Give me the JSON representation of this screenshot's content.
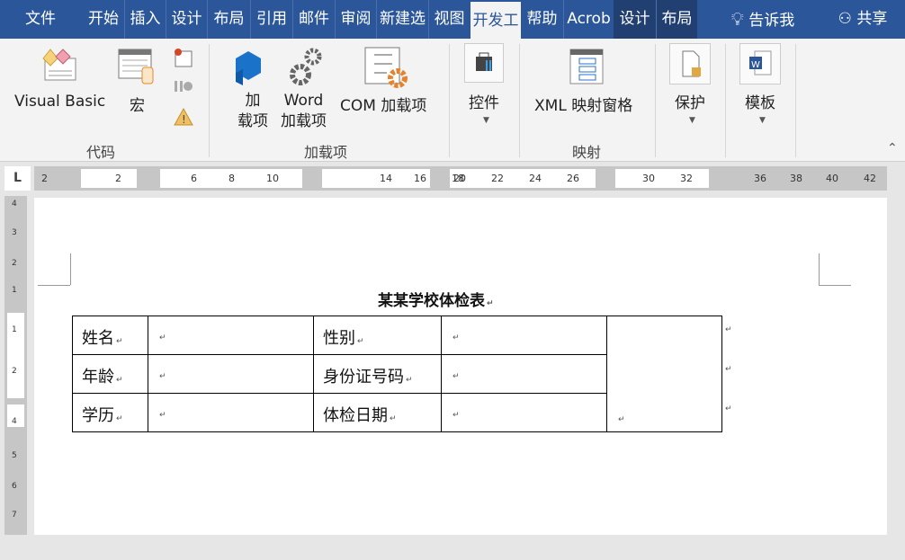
{
  "tabs": [
    {
      "label": "文件"
    },
    {
      "label": "开始"
    },
    {
      "label": "插入"
    },
    {
      "label": "设计"
    },
    {
      "label": "布局"
    },
    {
      "label": "引用"
    },
    {
      "label": "邮件"
    },
    {
      "label": "审阅"
    },
    {
      "label": "新建选"
    },
    {
      "label": "视图"
    },
    {
      "label": "开发工"
    },
    {
      "label": "帮助"
    },
    {
      "label": "Acrob"
    },
    {
      "label": "设计"
    },
    {
      "label": "布局"
    }
  ],
  "tell_me": "告诉我",
  "share": "共享",
  "active_tab": "开发工具",
  "ribbon": {
    "groups": [
      {
        "label": "代码",
        "buttons": [
          "Visual Basic",
          "宏"
        ]
      },
      {
        "label": "加载项",
        "buttons": [
          "加\n载项",
          "Word\n加载项",
          "COM 加载项"
        ]
      },
      {
        "label": "",
        "buttons": [
          "控件"
        ]
      },
      {
        "label": "映射",
        "buttons": [
          "XML 映射窗格"
        ]
      },
      {
        "label": "",
        "buttons": [
          "保护"
        ]
      },
      {
        "label": "",
        "buttons": [
          "模板"
        ]
      }
    ],
    "addin_line1": "加",
    "addin_line2": "载项",
    "word_line1": "Word",
    "word_line2": "加载项"
  },
  "ruler": {
    "ticks": [
      "2",
      "2",
      "6",
      "8",
      "10",
      "14",
      "16",
      "18",
      "20",
      "22",
      "24",
      "26",
      "30",
      "32",
      "36",
      "38",
      "40",
      "42"
    ]
  },
  "vruler": {
    "ticks": [
      "4",
      "3",
      "2",
      "1",
      "1",
      "2",
      "4",
      "5",
      "6",
      "7"
    ]
  },
  "document": {
    "title": "某某学校体检表",
    "table": [
      [
        "姓名",
        "",
        "性别",
        ""
      ],
      [
        "年龄",
        "",
        "身份证号码",
        ""
      ],
      [
        "学历",
        "",
        "体检日期",
        ""
      ]
    ]
  },
  "colors": {
    "brand": "#2b579a",
    "ribbon": "#f3f3f3"
  }
}
